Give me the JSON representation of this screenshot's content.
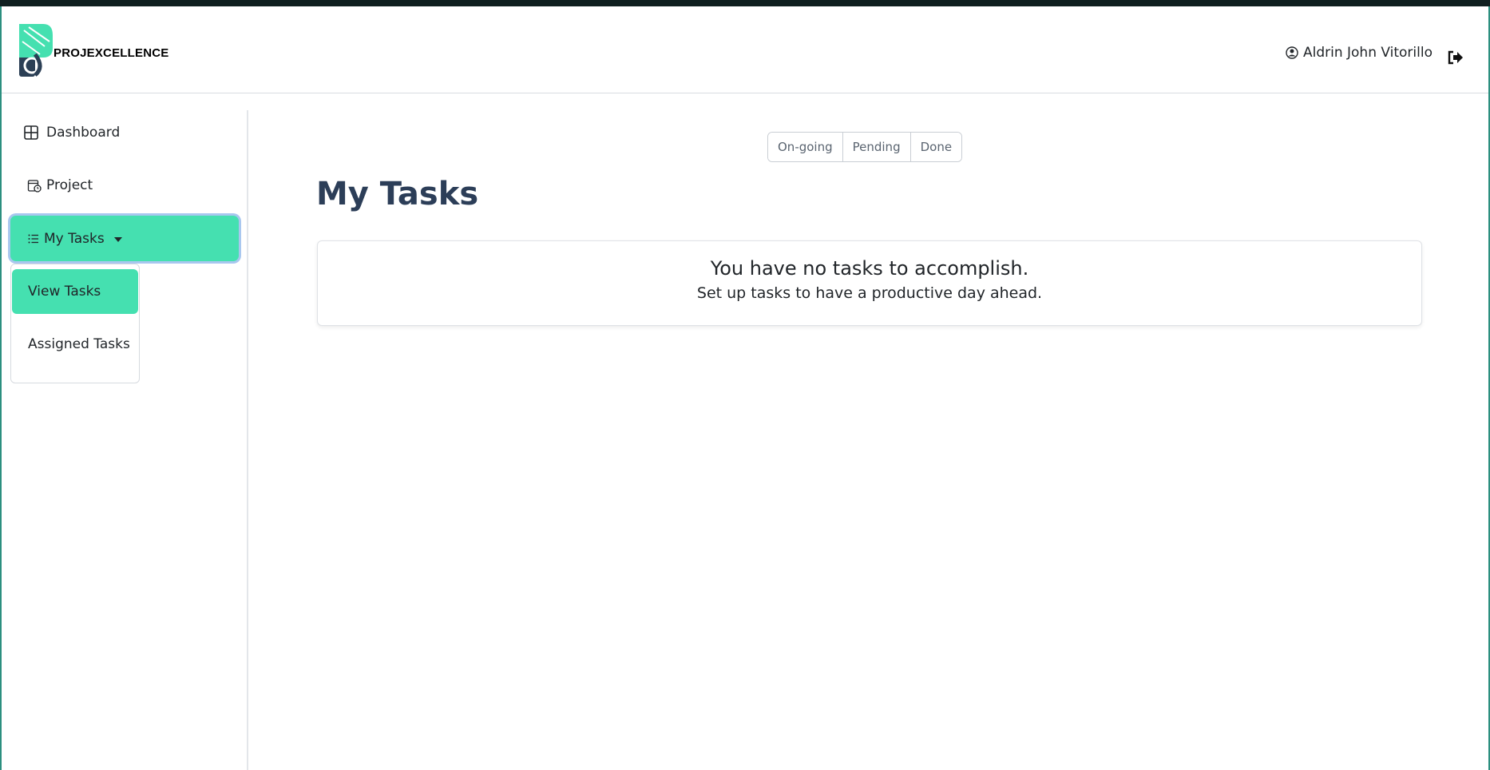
{
  "header": {
    "brand": "PROJEXCELLENCE",
    "user_name": "Aldrin John Vitorillo"
  },
  "sidebar": {
    "items": [
      {
        "label": "Dashboard",
        "icon": "grid-icon"
      },
      {
        "label": "Project",
        "icon": "calendar-icon"
      },
      {
        "label": "My Tasks",
        "icon": "list-icon",
        "active": true
      }
    ],
    "dropdown": [
      {
        "label": "View Tasks",
        "active": true
      },
      {
        "label": "Assigned Tasks"
      }
    ]
  },
  "filters": [
    "On-going",
    "Pending",
    "Done"
  ],
  "main": {
    "title": "My Tasks",
    "empty_title": "You have no tasks to accomplish.",
    "empty_subtitle": "Set up tasks to have a productive day ahead."
  },
  "colors": {
    "accent": "#45e0b0",
    "title": "#2c3e58",
    "topbar": "#0f1f1f"
  }
}
